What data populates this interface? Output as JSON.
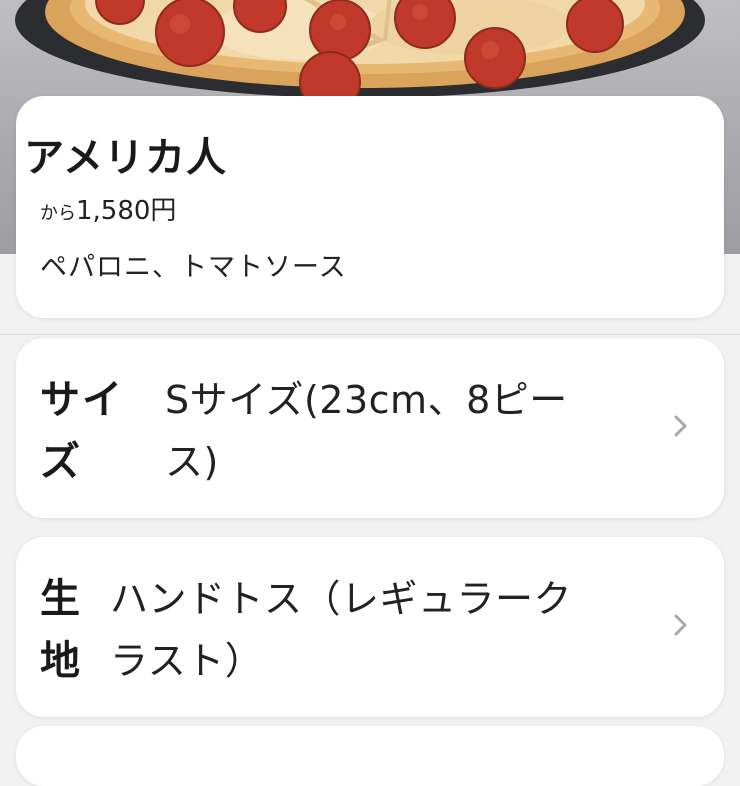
{
  "product": {
    "name": "アメリカ人",
    "price_prefix": "から",
    "price": "1,580円",
    "description": "ペパロニ、トマトソース"
  },
  "options": [
    {
      "label_line1": "サイ",
      "label_line2": "ズ",
      "value_line1": "Sサイズ(23cm、8ピー",
      "value_line2": "ス)",
      "chevron_icon": "chevron-right-icon"
    },
    {
      "label_line1": "生",
      "label_line2": "地",
      "value_line1": "ハンドトス（レギュラーク",
      "value_line2": "ラスト）",
      "chevron_icon": "chevron-right-icon"
    }
  ],
  "hero_image": "pepperoni-pizza-photo"
}
